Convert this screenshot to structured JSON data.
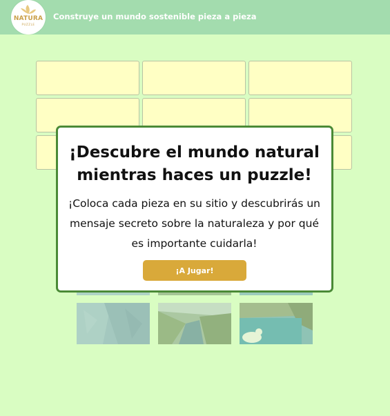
{
  "header": {
    "logo_text": "NATURA",
    "logo_subtext": "PUZZLE",
    "tagline": "Construye un mundo sostenible pieza a pieza"
  },
  "modal": {
    "title": "¡Descubre el mundo natural mientras haces un puzzle!",
    "text": "¡Coloca cada pieza en su sitio y descubrirás un mensaje secreto sobre la naturaleza y por qué es importante cuidarla!",
    "play_label": "¡A Jugar!"
  },
  "colors": {
    "background": "#d9fdc2",
    "header": "#a3dcae",
    "slot": "#ffffc4",
    "modal_border": "#4a8a36",
    "button": "#d9a93a"
  },
  "puzzle": {
    "slots": 9,
    "pieces": [
      "mountain-cliff",
      "valley-river",
      "lake-mountains"
    ]
  }
}
